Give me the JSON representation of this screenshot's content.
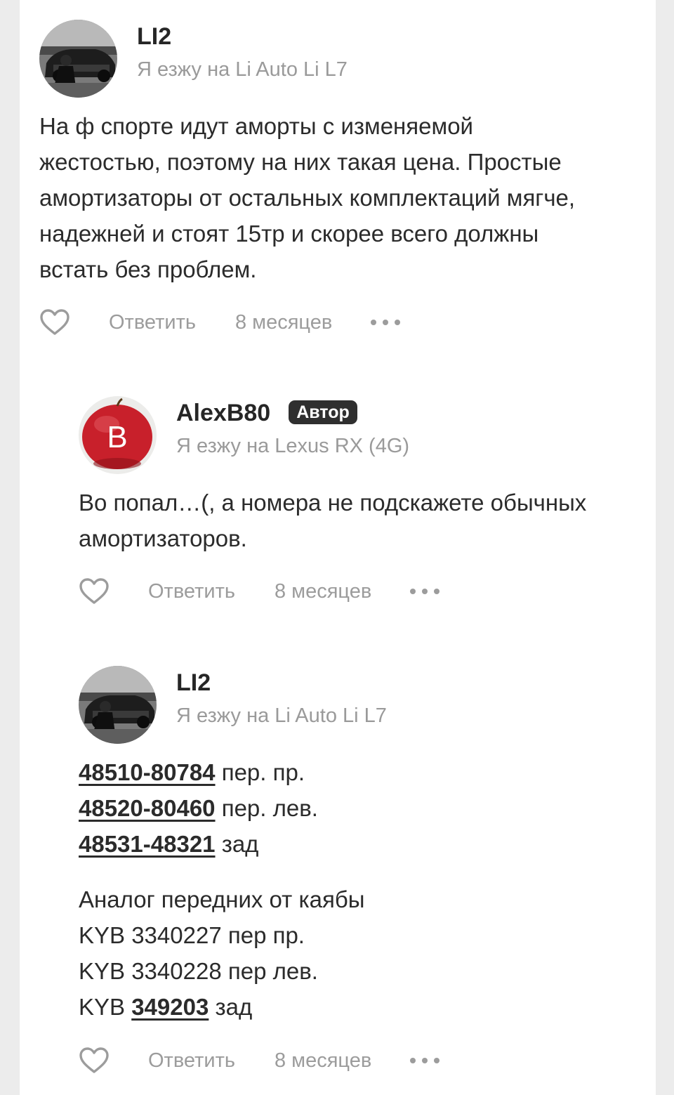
{
  "comments": [
    {
      "author": "LI2",
      "car": "Я езжу на Li Auto Li L7",
      "avatar_icon": "car-photo-avatar",
      "lines": [
        "На ф спорте идут аморты с изменяемой",
        "жестостью, поэтому на них такая цена. Простые",
        "амортизаторы от остальных комплектаций мягче,",
        "надежней и стоят 15тр и скорее всего должны",
        "встать без проблем."
      ],
      "reply_label": "Ответить",
      "time": "8 месяцев"
    },
    {
      "author": "AlexB80",
      "badge": "Автор",
      "car": "Я езжу на Lexus RX (4G)",
      "avatar_icon": "apple-letter-avatar",
      "avatar_letter": "B",
      "lines": [
        "Во попал…(, а номера не подскажете обычных",
        "амортизаторов."
      ],
      "reply_label": "Ответить",
      "time": "8 месяцев"
    },
    {
      "author": "LI2",
      "car": "Я езжу на Li Auto Li L7",
      "avatar_icon": "car-photo-avatar",
      "parts": [
        {
          "code": "48510-80784",
          "desc": " пер. пр."
        },
        {
          "code": "48520-80460",
          "desc": " пер. лев."
        },
        {
          "code": "48531-48321",
          "desc": " зад"
        }
      ],
      "analog_title": "Аналог передних от каябы",
      "analog_lines": [
        "KYB 3340227 пер пр.",
        "KYB 3340228 пер лев."
      ],
      "kyb_prefix": "KYB ",
      "kyb_code": "349203",
      "kyb_suffix": " зад",
      "reply_label": "Ответить",
      "time": "8 месяцев"
    }
  ],
  "colors": {
    "text": "#2b2b2b",
    "muted": "#9a9a9a",
    "badge_bg": "#2f2f2f",
    "apple_red": "#c8202b"
  }
}
